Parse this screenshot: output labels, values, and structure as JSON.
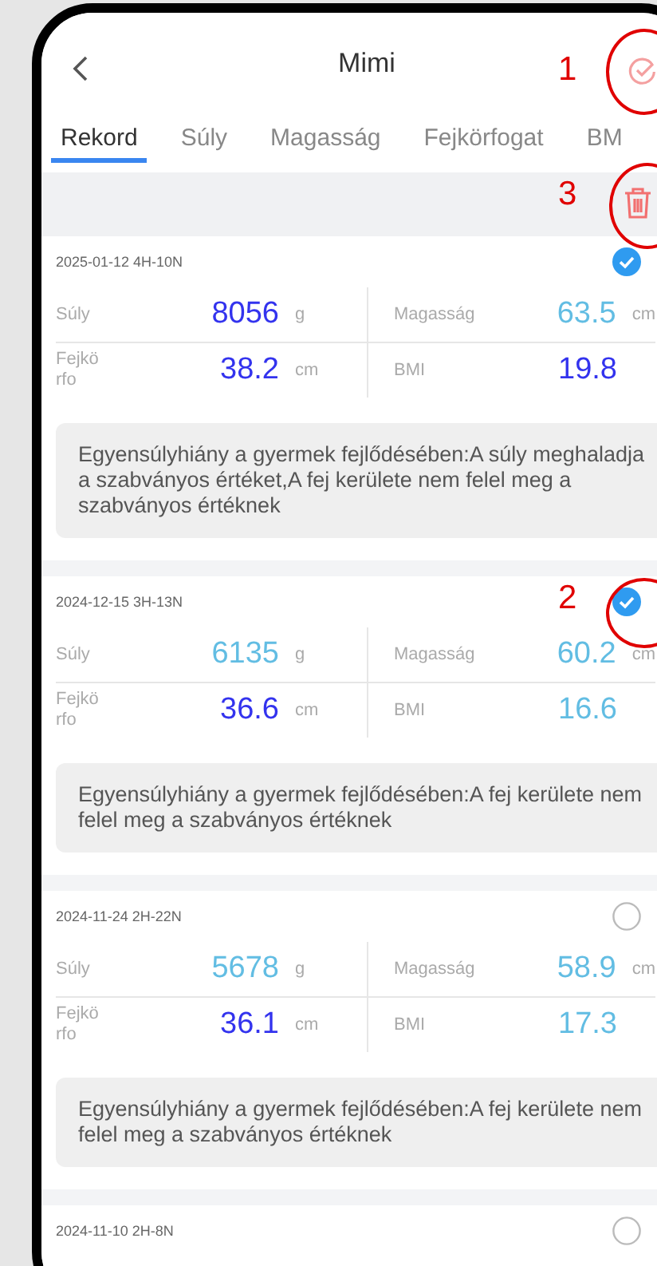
{
  "header": {
    "title": "Mimi",
    "annotation": "1"
  },
  "tabs": [
    {
      "label": "Rekord",
      "selected": true
    },
    {
      "label": "Súly",
      "selected": false
    },
    {
      "label": "Magasság",
      "selected": false
    },
    {
      "label": "Fejkörfogat",
      "selected": false
    },
    {
      "label": "BM",
      "selected": false
    }
  ],
  "toolbar": {
    "annotation": "3"
  },
  "records": [
    {
      "date": "2025-01-12 4H-10N",
      "selected": true,
      "metrics": [
        {
          "label": "Súly",
          "value": "8056",
          "unit": "g",
          "abnormal": true
        },
        {
          "label": "Magasság",
          "value": "63.5",
          "unit": "cm",
          "abnormal": false
        },
        {
          "label": "Fejkörfo",
          "value": "38.2",
          "unit": "cm",
          "abnormal": true
        },
        {
          "label": "BMI",
          "value": "19.8",
          "abnormal": true
        }
      ],
      "note": "Egyensúlyhiány a gyermek fejlődésében:A súly meghaladja a szabványos értéket,A fej kerülete nem felel meg a szabványos értéknek"
    },
    {
      "date": "2024-12-15 3H-13N",
      "selected": true,
      "annotation": "2",
      "metrics": [
        {
          "label": "Súly",
          "value": "6135",
          "unit": "g",
          "abnormal": false
        },
        {
          "label": "Magasság",
          "value": "60.2",
          "unit": "cm",
          "abnormal": false
        },
        {
          "label": "Fejkörfo",
          "value": "36.6",
          "unit": "cm",
          "abnormal": true
        },
        {
          "label": "BMI",
          "value": "16.6",
          "abnormal": false
        }
      ],
      "note": "Egyensúlyhiány a gyermek fejlődésében:A fej kerülete nem felel meg a szabványos értéknek"
    },
    {
      "date": "2024-11-24 2H-22N",
      "selected": false,
      "metrics": [
        {
          "label": "Súly",
          "value": "5678",
          "unit": "g",
          "abnormal": false
        },
        {
          "label": "Magasság",
          "value": "58.9",
          "unit": "cm",
          "abnormal": false
        },
        {
          "label": "Fejkörfo",
          "value": "36.1",
          "unit": "cm",
          "abnormal": true
        },
        {
          "label": "BMI",
          "value": "17.3",
          "abnormal": false
        }
      ],
      "note": "Egyensúlyhiány a gyermek fejlődésében:A fej kerülete nem felel meg a szabványos értéknek"
    },
    {
      "date": "2024-11-10 2H-8N",
      "selected": false
    }
  ]
}
